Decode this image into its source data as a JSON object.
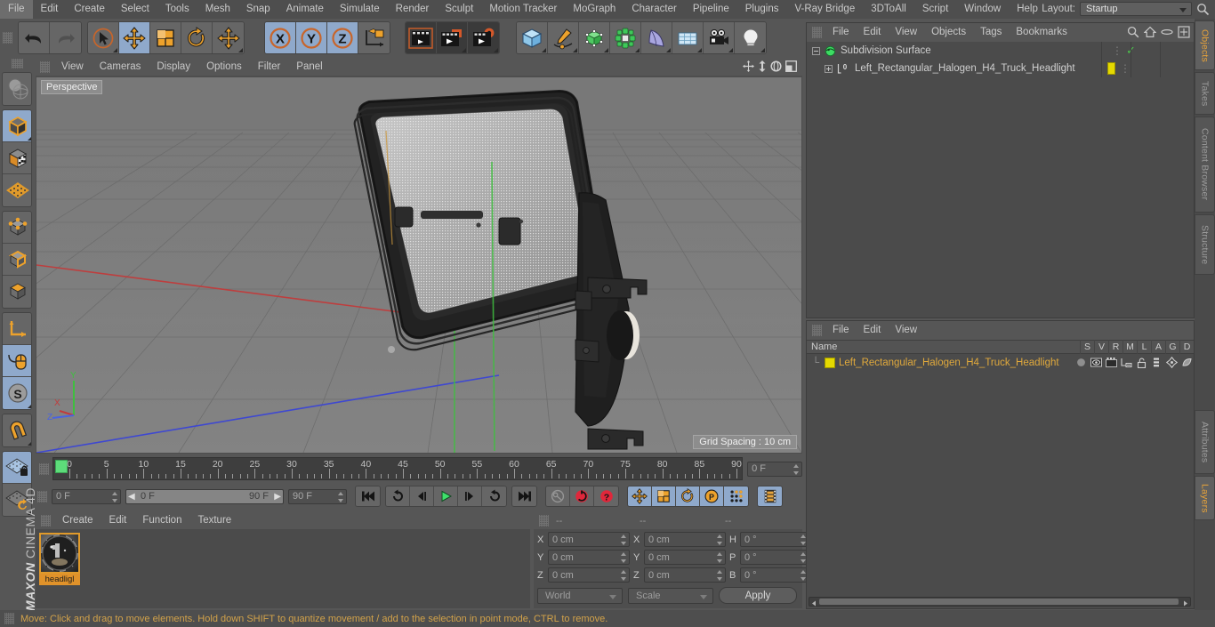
{
  "app": {
    "brand_line1": "MAXON",
    "brand_line2": "CINEMA 4D"
  },
  "menubar": {
    "items": [
      "File",
      "Edit",
      "Create",
      "Select",
      "Tools",
      "Mesh",
      "Snap",
      "Animate",
      "Simulate",
      "Render",
      "Sculpt",
      "Motion Tracker",
      "MoGraph",
      "Character",
      "Pipeline",
      "Plugins",
      "V-Ray Bridge",
      "3DToAll",
      "Script",
      "Window",
      "Help"
    ],
    "layout_label": "Layout:",
    "layout_value": "Startup",
    "search_icon": "search-icon"
  },
  "toolbar": {
    "groups": [
      {
        "name": "undo-redo",
        "buttons": [
          {
            "name": "undo-button",
            "icon": "undo-icon",
            "active": false
          },
          {
            "name": "redo-button",
            "icon": "redo-icon",
            "active": false,
            "disabled": true
          }
        ]
      },
      {
        "name": "transform-tools",
        "buttons": [
          {
            "name": "select-tool",
            "icon": "cursor-select-icon",
            "active": false
          },
          {
            "name": "move-tool",
            "icon": "move-icon",
            "active": true
          },
          {
            "name": "scale-tool",
            "icon": "scale-icon",
            "active": false
          },
          {
            "name": "rotate-tool",
            "icon": "rotate-icon",
            "active": false
          },
          {
            "name": "dynamic-place-tool",
            "icon": "move-icon",
            "active": false
          }
        ]
      },
      {
        "name": "axis-locks",
        "buttons": [
          {
            "name": "x-axis-lock",
            "icon": "x-axis-icon",
            "active": true
          },
          {
            "name": "y-axis-lock",
            "icon": "y-axis-icon",
            "active": true
          },
          {
            "name": "z-axis-lock",
            "icon": "z-axis-icon",
            "active": true
          },
          {
            "name": "world-object-axis",
            "icon": "world-coord-icon",
            "active": false
          }
        ]
      },
      {
        "name": "render-tools",
        "buttons": [
          {
            "name": "render-view-button",
            "icon": "render-view-icon",
            "active": false
          },
          {
            "name": "render-region-button",
            "icon": "render-region-icon",
            "active": false
          },
          {
            "name": "render-settings-button",
            "icon": "render-settings-icon",
            "active": false
          }
        ]
      },
      {
        "name": "create-objects",
        "buttons": [
          {
            "name": "add-cube-button",
            "icon": "cube-icon",
            "active": false
          },
          {
            "name": "add-spline-button",
            "icon": "pen-spline-icon",
            "active": false
          },
          {
            "name": "add-nurbs-button",
            "icon": "green-cube-icon",
            "active": false
          },
          {
            "name": "add-mograph-button",
            "icon": "cloner-icon",
            "active": false
          },
          {
            "name": "add-deformer-button",
            "icon": "bend-deformer-icon",
            "active": false
          },
          {
            "name": "add-environment-button",
            "icon": "floor-icon",
            "active": false
          },
          {
            "name": "add-camera-button",
            "icon": "camera-icon",
            "active": false
          },
          {
            "name": "add-light-button",
            "icon": "light-bulb-icon",
            "active": false
          }
        ]
      }
    ]
  },
  "left_toolbar": {
    "groups": [
      {
        "buttons": [
          {
            "name": "render-preview-tool",
            "icon": "globe-render-icon",
            "active": false
          }
        ]
      },
      {
        "buttons": [
          {
            "name": "model-mode-tool",
            "icon": "model-mode-icon",
            "active": true
          },
          {
            "name": "texture-mode-tool",
            "icon": "texture-mode-icon",
            "active": false
          },
          {
            "name": "workplane-tool",
            "icon": "workplane-icon",
            "active": false
          }
        ]
      },
      {
        "buttons": [
          {
            "name": "points-mode-tool",
            "icon": "points-mode-icon",
            "active": false
          },
          {
            "name": "edges-mode-tool",
            "icon": "edges-mode-icon",
            "active": false
          },
          {
            "name": "polygons-mode-tool",
            "icon": "polygons-mode-icon",
            "active": false
          }
        ]
      },
      {
        "buttons": [
          {
            "name": "axis-mode-tool",
            "icon": "axis-mode-icon",
            "active": false
          },
          {
            "name": "viewport-solo-tool",
            "icon": "mouse-tool-icon",
            "active": true
          },
          {
            "name": "enable-snap-tool",
            "icon": "snap-s-icon",
            "active": true
          }
        ]
      },
      {
        "buttons": [
          {
            "name": "magnet-tool",
            "icon": "magnet-icon",
            "active": false
          }
        ]
      },
      {
        "buttons": [
          {
            "name": "workplane-lock-tool",
            "icon": "workplane-lock-icon",
            "active": true
          },
          {
            "name": "workplane-rotate-tool",
            "icon": "workplane-rotate-icon",
            "active": false
          }
        ]
      }
    ]
  },
  "viewport": {
    "menu": [
      "View",
      "Cameras",
      "Display",
      "Options",
      "Filter",
      "Panel"
    ],
    "corner_icons": [
      "pan-icon",
      "dolly-icon",
      "orbit-icon",
      "maximize-icon"
    ],
    "view_label": "Perspective",
    "grid_spacing": "Grid Spacing : 10 cm",
    "axis_gizmo": {
      "x": "X",
      "y": "Y",
      "z": "Z",
      "x_color": "#d04040",
      "y_color": "#3fc43f",
      "z_color": "#4a63e0"
    }
  },
  "timeline": {
    "ticks": [
      {
        "label": "0",
        "value": 0
      },
      {
        "label": "5",
        "value": 5
      },
      {
        "label": "10",
        "value": 10
      },
      {
        "label": "15",
        "value": 15
      },
      {
        "label": "20",
        "value": 20
      },
      {
        "label": "25",
        "value": 25
      },
      {
        "label": "30",
        "value": 30
      },
      {
        "label": "35",
        "value": 35
      },
      {
        "label": "40",
        "value": 40
      },
      {
        "label": "45",
        "value": 45
      },
      {
        "label": "50",
        "value": 50
      },
      {
        "label": "55",
        "value": 55
      },
      {
        "label": "60",
        "value": 60
      },
      {
        "label": "65",
        "value": 65
      },
      {
        "label": "70",
        "value": 70
      },
      {
        "label": "75",
        "value": 75
      },
      {
        "label": "80",
        "value": 80
      },
      {
        "label": "85",
        "value": 85
      },
      {
        "label": "90",
        "value": 90
      }
    ],
    "current_frame_field": "0 F",
    "playhead_frame": 0
  },
  "playback": {
    "current_frame": "0 F",
    "range_start": "0 F",
    "range_end": "90 F",
    "max_frame": "90 F",
    "buttons": [
      {
        "name": "go-to-start-button",
        "icon": "skip-start-icon",
        "active": false
      },
      {
        "name": "play-backwards-keyframe-button",
        "icon": "rewind-loop-icon",
        "active": false
      },
      {
        "name": "step-back-button",
        "icon": "step-back-icon",
        "active": false
      },
      {
        "name": "play-button",
        "icon": "play-icon",
        "active": false
      },
      {
        "name": "step-forward-button",
        "icon": "step-forward-icon",
        "active": false
      },
      {
        "name": "loop-button",
        "icon": "loop-icon",
        "active": false
      },
      {
        "name": "go-to-end-button",
        "icon": "skip-end-icon",
        "active": false
      },
      {
        "name": "autokey-button",
        "icon": "key-icon",
        "active": false
      },
      {
        "name": "record-button",
        "icon": "record-icon",
        "active": false
      },
      {
        "name": "keyframe-selection-button",
        "icon": "question-key-icon",
        "active": false
      },
      {
        "name": "record-position-button",
        "icon": "move-icon",
        "active": true
      },
      {
        "name": "record-scale-button",
        "icon": "scale-icon",
        "active": true
      },
      {
        "name": "record-rotation-button",
        "icon": "rotate-icon",
        "active": true
      },
      {
        "name": "record-pla-button",
        "icon": "pla-icon",
        "active": true
      },
      {
        "name": "record-parameter-button",
        "icon": "dots-grid-icon",
        "active": true
      },
      {
        "name": "timeline-toggle-button",
        "icon": "filmstrip-icon",
        "active": true
      }
    ]
  },
  "material_manager": {
    "menu": [
      "Create",
      "Edit",
      "Function",
      "Texture"
    ],
    "materials": [
      {
        "name": "headligl",
        "selected": true
      }
    ]
  },
  "coordinates": {
    "headers": [
      "--",
      "--",
      "--"
    ],
    "rows": [
      {
        "label_pos": "X",
        "value_pos": "0 cm",
        "label_size": "X",
        "value_size": "0 cm",
        "label_rot": "H",
        "value_rot": "0 °"
      },
      {
        "label_pos": "Y",
        "value_pos": "0 cm",
        "label_size": "Y",
        "value_size": "0 cm",
        "label_rot": "P",
        "value_rot": "0 °"
      },
      {
        "label_pos": "Z",
        "value_pos": "0 cm",
        "label_size": "Z",
        "value_size": "0 cm",
        "label_rot": "B",
        "value_rot": "0 °"
      }
    ],
    "system_dropdown": "World",
    "mode_dropdown": "Scale",
    "apply_button": "Apply"
  },
  "object_manager": {
    "menu": [
      "File",
      "Edit",
      "View",
      "Objects",
      "Tags",
      "Bookmarks"
    ],
    "header_icons": [
      "search-icon",
      "home-icon",
      "ellipse-icon",
      "fit-icon"
    ],
    "rows": [
      {
        "name": "Subdivision Surface",
        "indent": 0,
        "icon": "subdivision-surface-icon",
        "tag_color": "#8c8c8c",
        "check": true
      },
      {
        "name": "Left_Rectangular_Halogen_H4_Truck_Headlight",
        "indent": 1,
        "icon": "null-object-icon",
        "tag_color": "#e5d900",
        "check": false
      }
    ]
  },
  "layer_manager": {
    "menu": [
      "File",
      "Edit",
      "View"
    ],
    "columns": [
      "Name",
      "S",
      "V",
      "R",
      "M",
      "L",
      "A",
      "G",
      "D"
    ],
    "rows": [
      {
        "name": "Left_Rectangular_Halogen_H4_Truck_Headlight",
        "swatch": "#e5d900"
      }
    ]
  },
  "right_tabs": {
    "top": [
      {
        "label": "Objects",
        "active": true
      },
      {
        "label": "Takes",
        "active": false
      },
      {
        "label": "Content Browser",
        "active": false
      },
      {
        "label": "Structure",
        "active": false
      }
    ],
    "bottom": [
      {
        "label": "Attributes",
        "active": false
      },
      {
        "label": "Layers",
        "active": true
      }
    ]
  },
  "statusbar": {
    "message": "Move: Click and drag to move elements. Hold down SHIFT to quantize movement / add to the selection in point mode, CTRL to remove."
  },
  "colors": {
    "accent_orange": "#e0922a",
    "highlight_blue": "#8fa9cb",
    "panel_bg": "#4b4b4b",
    "chrome_bg": "#565656",
    "text": "#c8c8c8",
    "layer_text": "#e0a93c"
  }
}
